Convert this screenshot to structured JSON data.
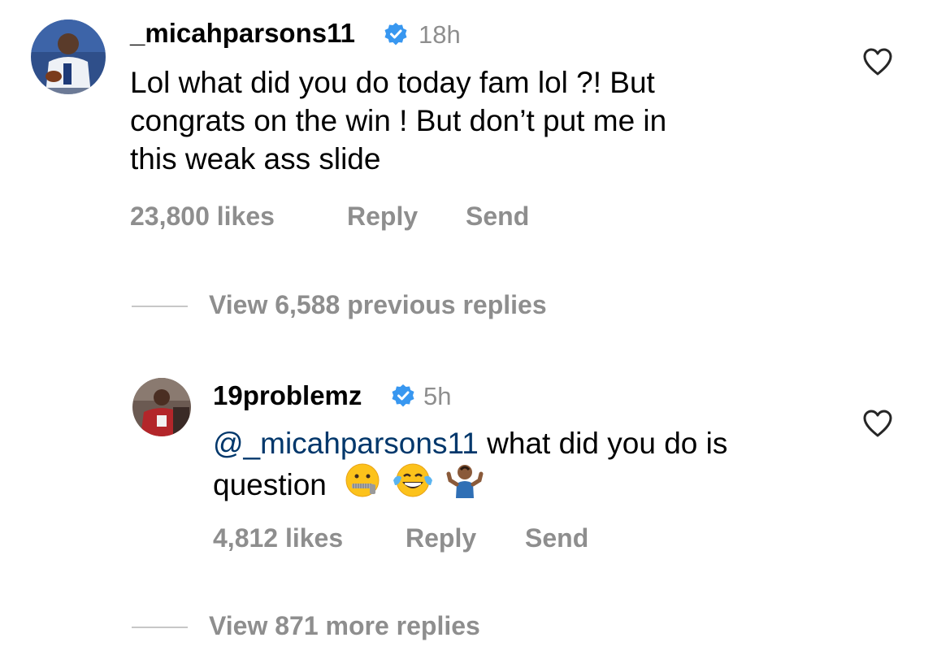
{
  "comment": {
    "username": "_micahparsons11",
    "time": "18h",
    "text": "Lol what did you do today fam lol ?! But congrats on the win ! But don’t put me in this weak ass slide",
    "text_lines": [
      "Lol what did you do today fam lol ?! But",
      "congrats on the win ! But don’t put me in",
      "this weak ass slide"
    ],
    "likes": "23,800 likes",
    "reply_label": "Reply",
    "send_label": "Send",
    "view_previous": "View 6,588 previous replies"
  },
  "reply": {
    "username": "19problemz",
    "time": "5h",
    "mention": "@_micahparsons11",
    "text_line1": " what did you do is",
    "text_line2": "question",
    "emojis": [
      "zipper-mouth-face",
      "face-with-tears-of-joy",
      "person-shrugging"
    ],
    "likes": "4,812 likes",
    "reply_label": "Reply",
    "send_label": "Send",
    "view_more": "View 871 more replies"
  },
  "colors": {
    "secondary_text": "#8e8e8e",
    "mention": "#00376b",
    "verified_badge": "#3897f0"
  }
}
